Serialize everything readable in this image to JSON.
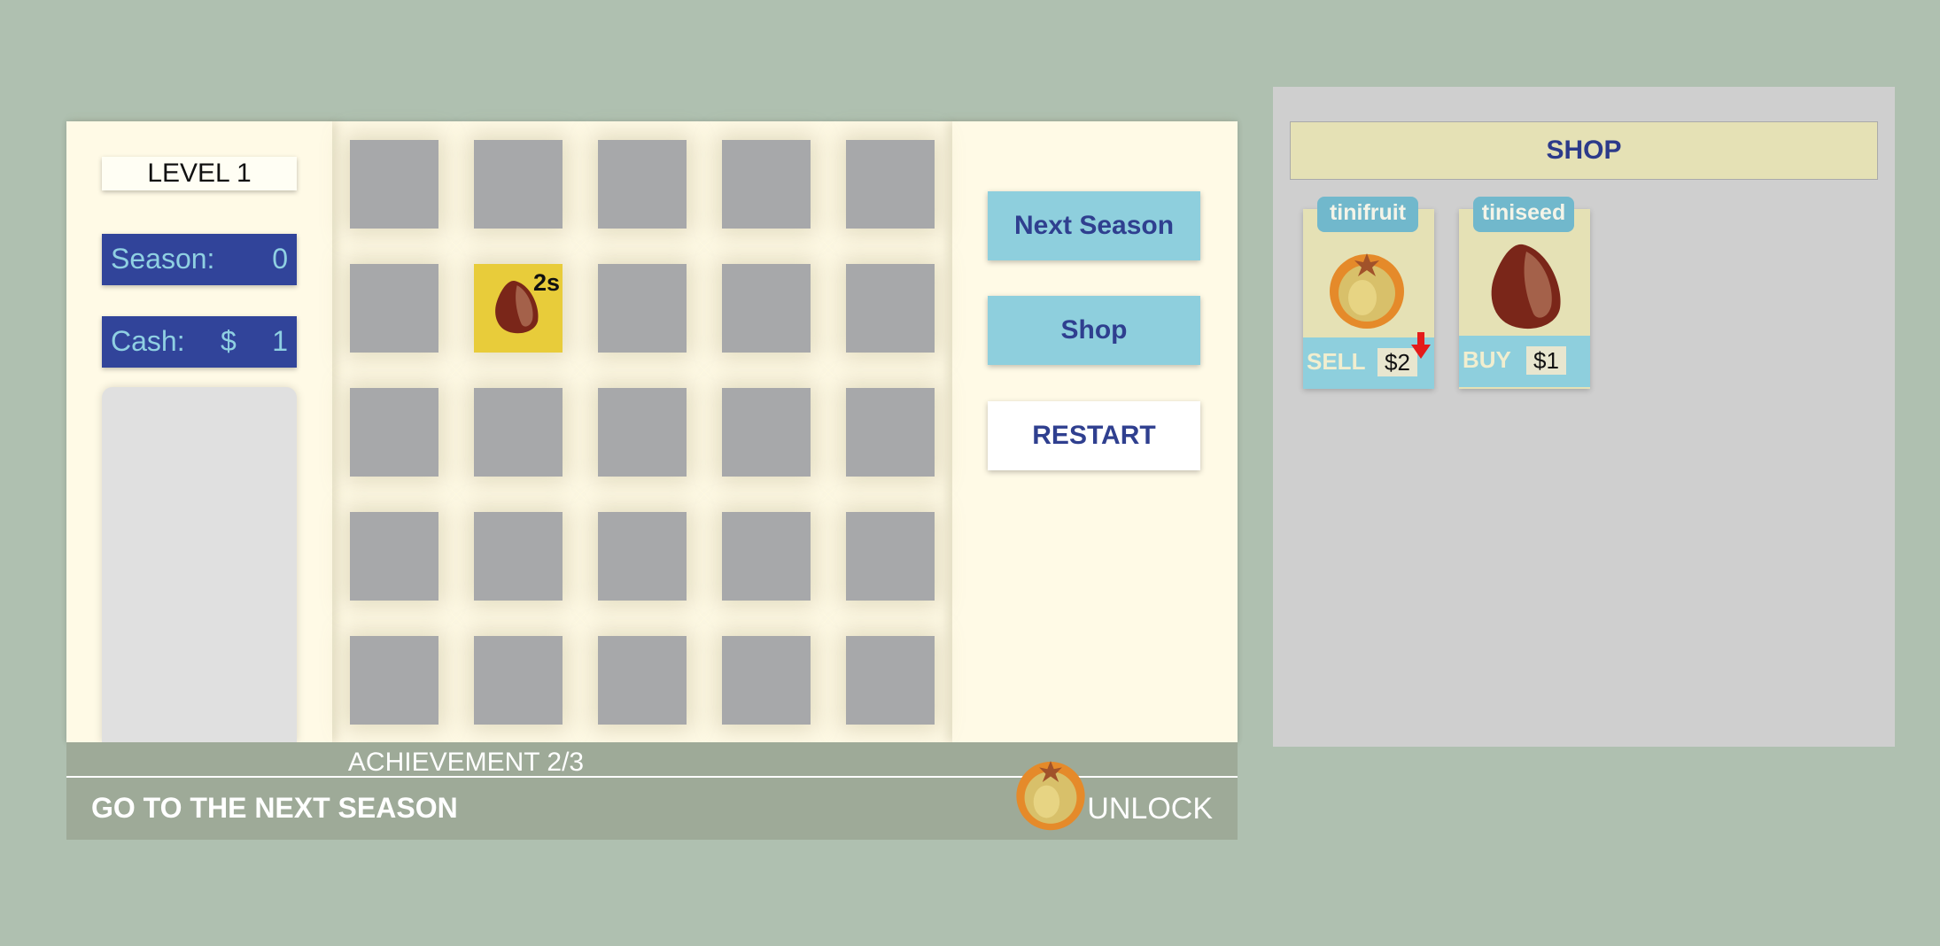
{
  "level": {
    "label": "LEVEL 1"
  },
  "stats": {
    "season_label": "Season:",
    "season_value": "0",
    "cash_label": "Cash:",
    "cash_symbol": "$",
    "cash_value": "1"
  },
  "grid": {
    "rows": 5,
    "cols": 5,
    "planted": [
      {
        "row": 1,
        "col": 1,
        "item": "tiniseed",
        "timer": "2s"
      }
    ]
  },
  "buttons": {
    "next_season": "Next Season",
    "shop": "Shop",
    "restart": "RESTART"
  },
  "achievement": {
    "title": "ACHIEVEMENT 2/3",
    "description": "GO TO THE NEXT SEASON",
    "unlock": "UNLOCK",
    "reward_icon": "tinifruit-icon"
  },
  "shop": {
    "title": "SHOP",
    "items": [
      {
        "name": "tinifruit",
        "action": "SELL",
        "price": "$2",
        "trend": "down",
        "icon": "tinifruit-icon"
      },
      {
        "name": "tiniseed",
        "action": "BUY",
        "price": "$1",
        "icon": "tiniseed-icon"
      }
    ]
  },
  "colors": {
    "background": "#afc0b0",
    "panel": "#fffae6",
    "stat_bg": "#31449a",
    "stat_text": "#8fd0e2",
    "button_blue": "#8ecfdd",
    "button_text": "#2f3f8f",
    "cell": "#a7a8aa",
    "planted_cell": "#e8cc3a",
    "shop_bg": "#cfcfcf",
    "card_bg": "#e5e1b5"
  }
}
